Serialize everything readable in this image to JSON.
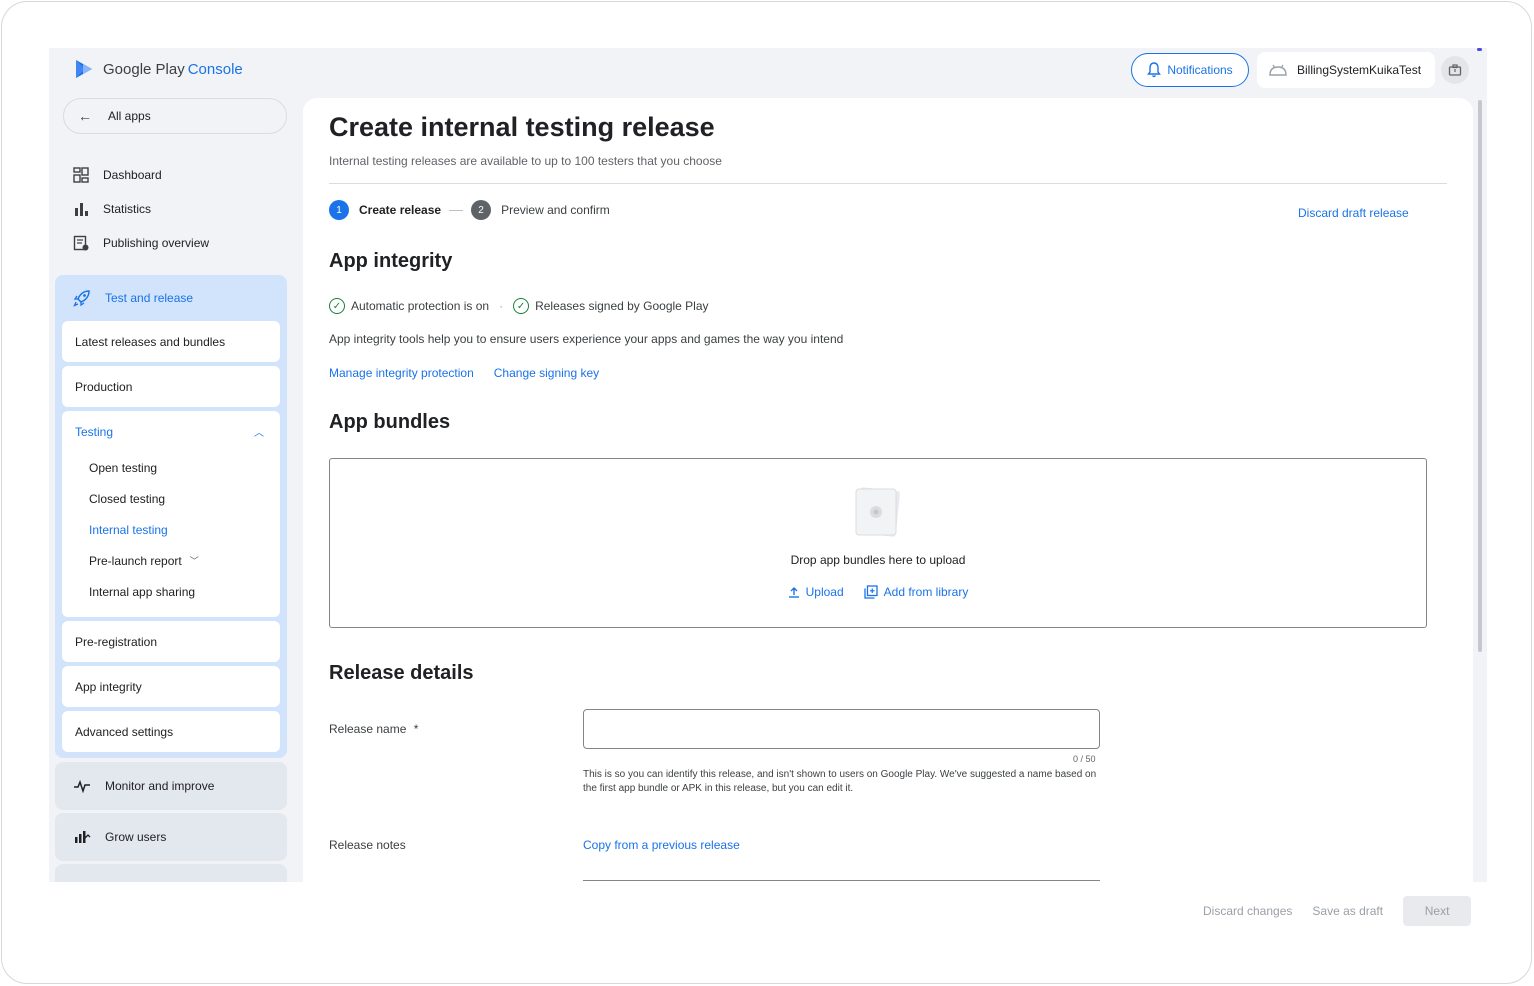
{
  "header": {
    "logo_brand": "Google Play",
    "logo_product": "Console",
    "notifications_label": "Notifications",
    "account_name": "BillingSystemKuikaTest"
  },
  "sidebar": {
    "all_apps": "All apps",
    "top_items": [
      {
        "label": "Dashboard",
        "icon": "dashboard-icon"
      },
      {
        "label": "Statistics",
        "icon": "bar-chart-icon"
      },
      {
        "label": "Publishing overview",
        "icon": "publishing-icon"
      }
    ],
    "test_release": {
      "label": "Test and release",
      "items": [
        "Latest releases and bundles",
        "Production"
      ],
      "testing": {
        "label": "Testing",
        "sub_items": [
          "Open testing",
          "Closed testing",
          "Internal testing",
          "Pre-launch report",
          "Internal app sharing"
        ],
        "active": "Internal testing"
      },
      "items_after": [
        "Pre-registration",
        "App integrity",
        "Advanced settings"
      ]
    },
    "monitor_improve": "Monitor and improve",
    "grow_users": "Grow users"
  },
  "main": {
    "title": "Create internal testing release",
    "subtitle": "Internal testing releases are available to up to 100 testers that you choose",
    "steps": [
      {
        "num": "1",
        "label": "Create release"
      },
      {
        "num": "2",
        "label": "Preview and confirm"
      }
    ],
    "discard_draft": "Discard draft release",
    "app_integrity": {
      "heading": "App integrity",
      "check1": "Automatic protection is on",
      "separator": "·",
      "check2": "Releases signed by Google Play",
      "description": "App integrity tools help you to ensure users experience your apps and games the way you intend",
      "link1": "Manage integrity protection",
      "link2": "Change signing key"
    },
    "app_bundles": {
      "heading": "App bundles",
      "drop_text": "Drop app bundles here to upload",
      "upload": "Upload",
      "add_from_library": "Add from library"
    },
    "release_details": {
      "heading": "Release details",
      "name_label": "Release name",
      "required_mark": "*",
      "name_value": "",
      "counter": "0 / 50",
      "hint": "This is so you can identify this release, and isn't shown to users on Google Play. We've suggested a name based on the first app bundle or APK in this release, but you can edit it.",
      "notes_label": "Release notes",
      "copy_link": "Copy from a previous release"
    }
  },
  "footer": {
    "discard_changes": "Discard changes",
    "save_draft": "Save as draft",
    "next": "Next"
  },
  "colors": {
    "accent": "#1a73e8",
    "nav_active_bg": "#d2e3fc",
    "success": "#188038"
  }
}
